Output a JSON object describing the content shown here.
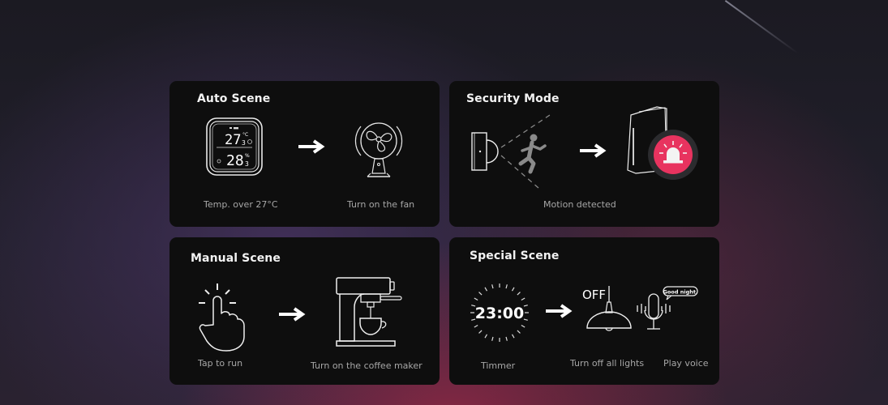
{
  "cards": {
    "auto": {
      "title": "Auto Scene",
      "trigger": {
        "caption": "Temp. over 27°C",
        "icon": "thermometer-display-icon",
        "display_temp": "27",
        "display_temp_decimal": "3",
        "display_temp_unit": "°C",
        "display_humidity": "28",
        "display_humidity_decimal": "3",
        "display_humidity_unit": "%"
      },
      "action": {
        "caption": "Turn on the fan",
        "icon": "fan-icon"
      }
    },
    "security": {
      "title": "Security Mode",
      "trigger": {
        "caption": "Motion detected",
        "icon": "motion-sensor-icon"
      },
      "action": {
        "icon": "hub-alarm-icon",
        "accent": "#e8335f"
      }
    },
    "manual": {
      "title": "Manual Scene",
      "trigger": {
        "caption": "Tap to run",
        "icon": "tap-hand-icon"
      },
      "action": {
        "caption": "Turn on the coffee maker",
        "icon": "coffee-maker-icon"
      }
    },
    "special": {
      "title": "Special Scene",
      "trigger": {
        "caption": "Timmer",
        "icon": "timer-clock-icon",
        "time": "23:00"
      },
      "actions": [
        {
          "caption": "Turn off all lights",
          "icon": "pendant-lamp-icon",
          "label": "OFF"
        },
        {
          "caption": "Play voice",
          "icon": "microphone-icon",
          "bubble": "Good night."
        }
      ]
    }
  },
  "colors": {
    "card_bg": "#0e0e0e",
    "alarm_accent": "#e8335f",
    "caption": "#a7a7a7"
  }
}
